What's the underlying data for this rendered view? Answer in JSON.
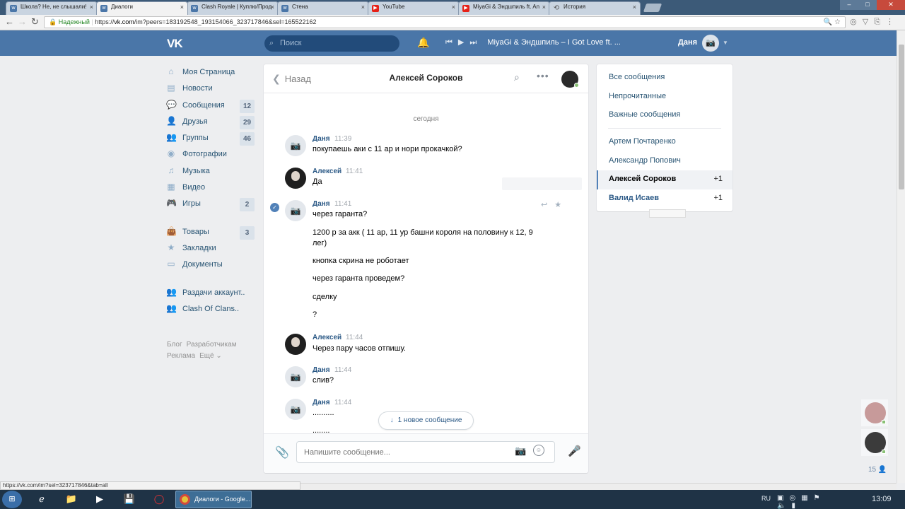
{
  "browser": {
    "tabs": [
      {
        "title": "Школа? Не, не слышали!",
        "icon": "vk-icon"
      },
      {
        "title": "Диалоги",
        "icon": "vk-icon",
        "active": true
      },
      {
        "title": "Clash Royale | Куплю/Прод",
        "icon": "vk-icon"
      },
      {
        "title": "Стена",
        "icon": "vk-icon"
      },
      {
        "title": "YouTube",
        "icon": "youtube-icon"
      },
      {
        "title": "MiyaGi & Эндшпиль ft. An",
        "icon": "youtube-icon"
      },
      {
        "title": "История",
        "icon": "history-icon"
      }
    ],
    "secure_label": "Надежный",
    "url_prefix": "https://",
    "url_host": "vk.com",
    "url_rest": "/im?peers=183192548_193154066_323717846&sel=165522162",
    "status_url": "https://vk.com/im?sel=323717846&tab=all"
  },
  "header": {
    "logo": "VK",
    "search_placeholder": "Поиск",
    "track": "MiyaGi & Эндшпиль – I Got Love ft. ...",
    "user_name": "Даня"
  },
  "menu": {
    "items": [
      {
        "label": "Моя Страница",
        "icon": "home-icon",
        "badge": ""
      },
      {
        "label": "Новости",
        "icon": "news-icon",
        "badge": ""
      },
      {
        "label": "Сообщения",
        "icon": "messages-icon",
        "badge": "12"
      },
      {
        "label": "Друзья",
        "icon": "friends-icon",
        "badge": "29"
      },
      {
        "label": "Группы",
        "icon": "groups-icon",
        "badge": "46"
      },
      {
        "label": "Фотографии",
        "icon": "camera-icon",
        "badge": ""
      },
      {
        "label": "Музыка",
        "icon": "music-icon",
        "badge": ""
      },
      {
        "label": "Видео",
        "icon": "video-icon",
        "badge": ""
      },
      {
        "label": "Игры",
        "icon": "games-icon",
        "badge": "2"
      }
    ],
    "items2": [
      {
        "label": "Товары",
        "icon": "market-icon",
        "badge": "3"
      },
      {
        "label": "Закладки",
        "icon": "bookmarks-icon",
        "badge": ""
      },
      {
        "label": "Документы",
        "icon": "documents-icon",
        "badge": ""
      }
    ],
    "items3": [
      {
        "label": "Раздачи аккаунт..",
        "icon": "community-icon"
      },
      {
        "label": "Clash Of Clans..",
        "icon": "community-icon"
      }
    ],
    "footer": [
      "Блог",
      "Разработчикам",
      "Реклама",
      "Ещё ⌄"
    ]
  },
  "chat": {
    "back_label": "Назад",
    "title": "Алексей Сороков",
    "date_label": "сегодня",
    "messages": [
      {
        "author": "Даня",
        "time": "11:39",
        "lines": [
          "покупаешь аки с 11 ар и нори прокачкой?"
        ]
      },
      {
        "author": "Алексей",
        "time": "11:41",
        "lines": [
          "Да"
        ]
      },
      {
        "author": "Даня",
        "time": "11:41",
        "lines": [
          "через гаранта?",
          "1200 р за акк ( 11 ар, 11 ур башни короля на половину к 12, 9 лег)",
          "кнопка скрина не роботает",
          "через гаранта проведем?",
          "сделку",
          "?"
        ]
      },
      {
        "author": "Алексей",
        "time": "11:44",
        "lines": [
          "Через пару часов отпишу."
        ]
      },
      {
        "author": "Даня",
        "time": "11:44",
        "lines": [
          "слив?"
        ]
      },
      {
        "author": "Даня",
        "time": "11:44",
        "lines": [
          "..........",
          "........"
        ]
      }
    ],
    "new_messages": "1 новое сообщение",
    "input_placeholder": "Напишите сообщение..."
  },
  "right_panel": {
    "filters": [
      "Все сообщения",
      "Непрочитанные",
      "Важные сообщения"
    ],
    "dialogs": [
      {
        "name": "Артем Почтаренко",
        "count": ""
      },
      {
        "name": "Александр Попович",
        "count": ""
      },
      {
        "name": "Алексей Сороков",
        "count": "+1"
      },
      {
        "name": "Валид Исаев",
        "count": "+1"
      }
    ]
  },
  "friends_online_count": "15",
  "taskbar": {
    "task_label": "Диалоги - Google...",
    "lang": "RU",
    "clock": "13:09"
  }
}
